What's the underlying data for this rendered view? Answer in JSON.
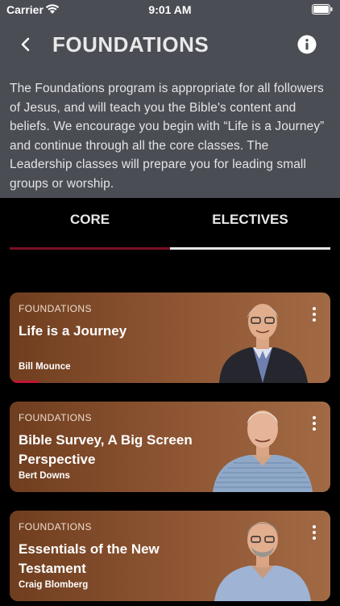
{
  "status_bar": {
    "carrier": "Carrier",
    "time": "9:01 AM"
  },
  "header": {
    "title": "FOUNDATIONS"
  },
  "description": "The Foundations program is appropriate for all followers of Jesus, and will teach you the Bible's content and beliefs. We encourage you begin with “Life is a Journey” and continue through all the core classes. The Leadership classes will prepare you for leading small groups or worship.",
  "tabs": [
    {
      "label": "CORE",
      "selected": true
    },
    {
      "label": "ELECTIVES",
      "selected": false
    }
  ],
  "colors": {
    "header_bg": "#4a4d54",
    "accent": "#7b1026",
    "progress": "#c21631"
  },
  "courses": [
    {
      "category": "FOUNDATIONS",
      "title": "Life is a Journey",
      "author": "Bill Mounce",
      "progress": 0.09
    },
    {
      "category": "FOUNDATIONS",
      "title": "Bible Survey, A Big Screen Perspective",
      "author": "Bert Downs"
    },
    {
      "category": "FOUNDATIONS",
      "title": "Essentials of the New Testament",
      "author": "Craig Blomberg"
    }
  ]
}
